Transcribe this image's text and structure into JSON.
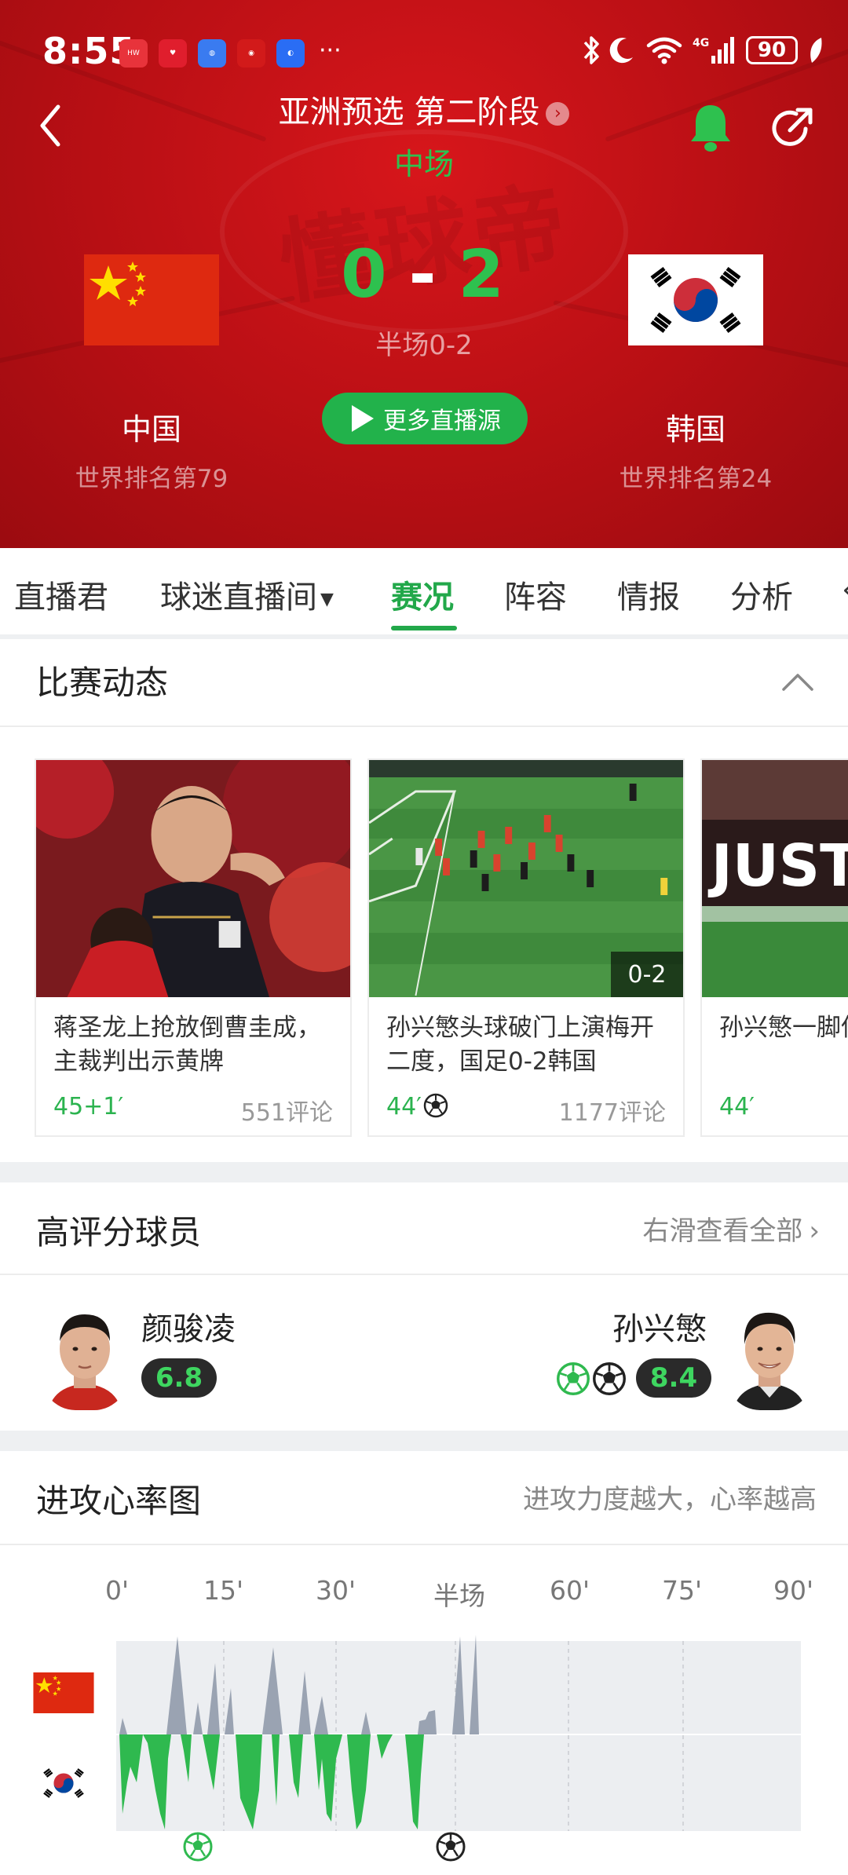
{
  "status_bar": {
    "time": "8:55",
    "battery": "90"
  },
  "header": {
    "league": "亚洲预选 第二阶段",
    "status": "中场",
    "home": {
      "name": "中国",
      "rank": "世界排名第79",
      "score": "0"
    },
    "away": {
      "name": "韩国",
      "rank": "世界排名第24",
      "score": "2"
    },
    "score_separator": "-",
    "halftime": "半场0-2",
    "more_live_label": "更多直播源",
    "watermark": "懂球帝"
  },
  "tabs": [
    "直播君",
    "球迷直播间",
    "赛况",
    "阵容",
    "情报",
    "分析"
  ],
  "active_tab": "赛况",
  "dynamics": {
    "title": "比赛动态",
    "items": [
      {
        "text": "蒋圣龙上抢放倒曹圭成，主裁判出示黄牌",
        "time": "45+1′",
        "comments": "551评论"
      },
      {
        "text": "孙兴慜头球破门上演梅开二度，国足0-2韩国",
        "time": "44′",
        "comments": "1177评论",
        "score": "0-2"
      },
      {
        "text": "孙兴慜一脚低射被王大雷将球扑出",
        "time": "44′",
        "thumb_text": "JUST"
      }
    ]
  },
  "top_players": {
    "title": "高评分球员",
    "see_all": "右滑查看全部",
    "home_player": {
      "name": "颜骏凌",
      "rating": "6.8"
    },
    "away_player": {
      "name": "孙兴慜",
      "rating": "8.4"
    }
  },
  "heart_rate": {
    "title": "进攻心率图",
    "hint": "进攻力度越大，心率越高",
    "minutes": [
      "0'",
      "15'",
      "30'",
      "半场",
      "60'",
      "75'",
      "90'"
    ]
  },
  "colors": {
    "brand_green": "#22a84a",
    "header_red": "#c4121a",
    "home_series": "#9aa3b2",
    "away_series": "#2fb94f"
  }
}
